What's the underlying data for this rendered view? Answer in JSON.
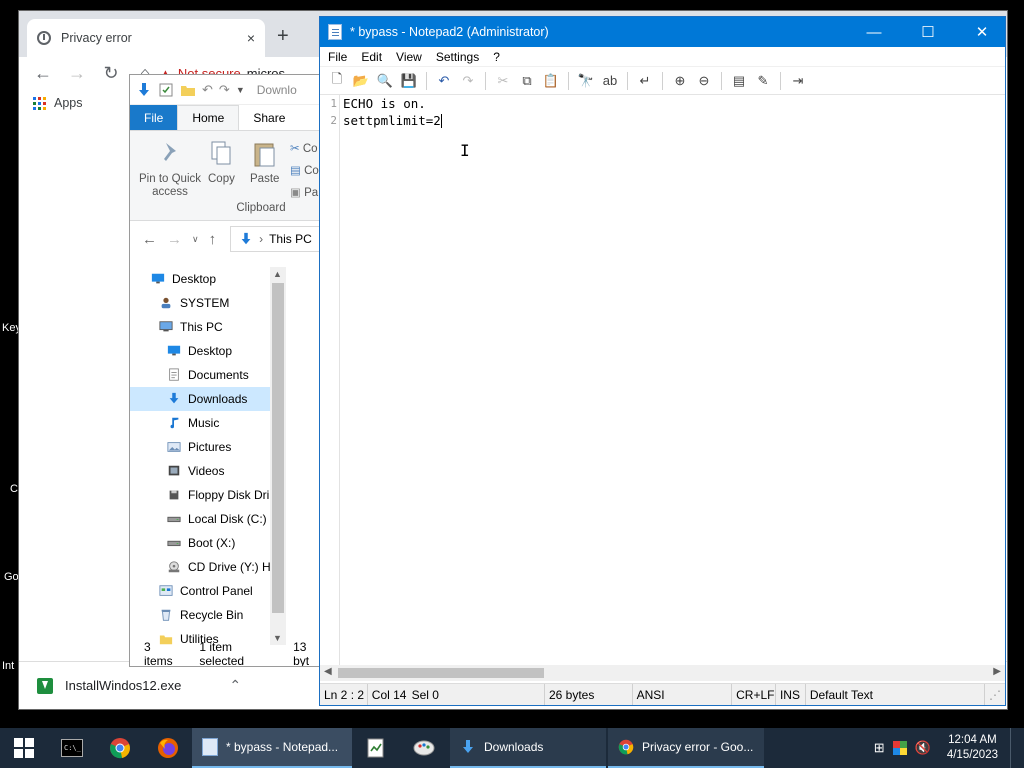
{
  "desktop": {
    "labels": [
      "Key",
      "C",
      "Go",
      "Int"
    ]
  },
  "chrome": {
    "tab_title": "Privacy error",
    "tab_close": "×",
    "new_tab": "+",
    "address_warning": "Not secure",
    "address_host": "micros",
    "bookmarks_apps": "Apps",
    "download_name": "InstallWindos12.exe"
  },
  "explorer": {
    "qat_trailing": "Downlo",
    "tabs": [
      "File",
      "Home",
      "Share"
    ],
    "ribbon": {
      "pin_label": "Pin to Quick access",
      "copy_label": "Copy",
      "paste_label": "Paste",
      "small_items": [
        "Co",
        "Co",
        "Pa"
      ],
      "group_label": "Clipboard"
    },
    "address_crumb": "This PC",
    "nav_items": [
      {
        "label": "Desktop",
        "icon": "desktop-icon",
        "indent": 0
      },
      {
        "label": "SYSTEM",
        "icon": "user-icon",
        "indent": 1
      },
      {
        "label": "This PC",
        "icon": "computer-icon",
        "indent": 1
      },
      {
        "label": "Desktop",
        "icon": "desktop-icon",
        "indent": 2
      },
      {
        "label": "Documents",
        "icon": "documents-icon",
        "indent": 2
      },
      {
        "label": "Downloads",
        "icon": "download-arrow-icon",
        "indent": 2,
        "selected": true
      },
      {
        "label": "Music",
        "icon": "music-icon",
        "indent": 2
      },
      {
        "label": "Pictures",
        "icon": "pictures-icon",
        "indent": 2
      },
      {
        "label": "Videos",
        "icon": "videos-icon",
        "indent": 2
      },
      {
        "label": "Floppy Disk Dri",
        "icon": "floppy-icon",
        "indent": 2
      },
      {
        "label": "Local Disk (C:)",
        "icon": "drive-icon",
        "indent": 2
      },
      {
        "label": "Boot (X:)",
        "icon": "drive-icon",
        "indent": 2
      },
      {
        "label": "CD Drive (Y:) H",
        "icon": "cd-drive-icon",
        "indent": 2
      },
      {
        "label": "Control Panel",
        "icon": "control-panel-icon",
        "indent": 1
      },
      {
        "label": "Recycle Bin",
        "icon": "recycle-bin-icon",
        "indent": 1
      },
      {
        "label": "Utilities",
        "icon": "folder-icon",
        "indent": 1
      }
    ],
    "status_items": "3 items",
    "status_selected": "1 item selected",
    "status_size": "13 byt"
  },
  "notepad": {
    "title": "* bypass - Notepad2 (Administrator)",
    "menu": [
      "File",
      "Edit",
      "View",
      "Settings",
      "?"
    ],
    "lines": [
      {
        "num": "1",
        "text": "ECHO is on."
      },
      {
        "num": "2",
        "text": "settpmlimit=2"
      }
    ],
    "status": {
      "position": "Ln 2 : 2",
      "column": "Col 14",
      "selection": "Sel 0",
      "size": "26 bytes",
      "encoding": "ANSI",
      "line_endings": "CR+LF",
      "mode": "INS",
      "scheme": "Default Text"
    }
  },
  "taskbar": {
    "tasks": [
      {
        "label": "* bypass - Notepad...",
        "icon": "notepad-icon",
        "active": true
      },
      {
        "label": "Downloads",
        "icon": "explorer-download-icon"
      },
      {
        "label": "Privacy error - Goo...",
        "icon": "chrome-icon"
      }
    ],
    "time": "12:04 AM",
    "date": "4/15/2023"
  },
  "colors": {
    "notepad_title": "#0078d7",
    "explorer_file_tab": "#1979ca",
    "taskbar": "#1c2a3a",
    "selected_nav": "#cce8ff"
  }
}
